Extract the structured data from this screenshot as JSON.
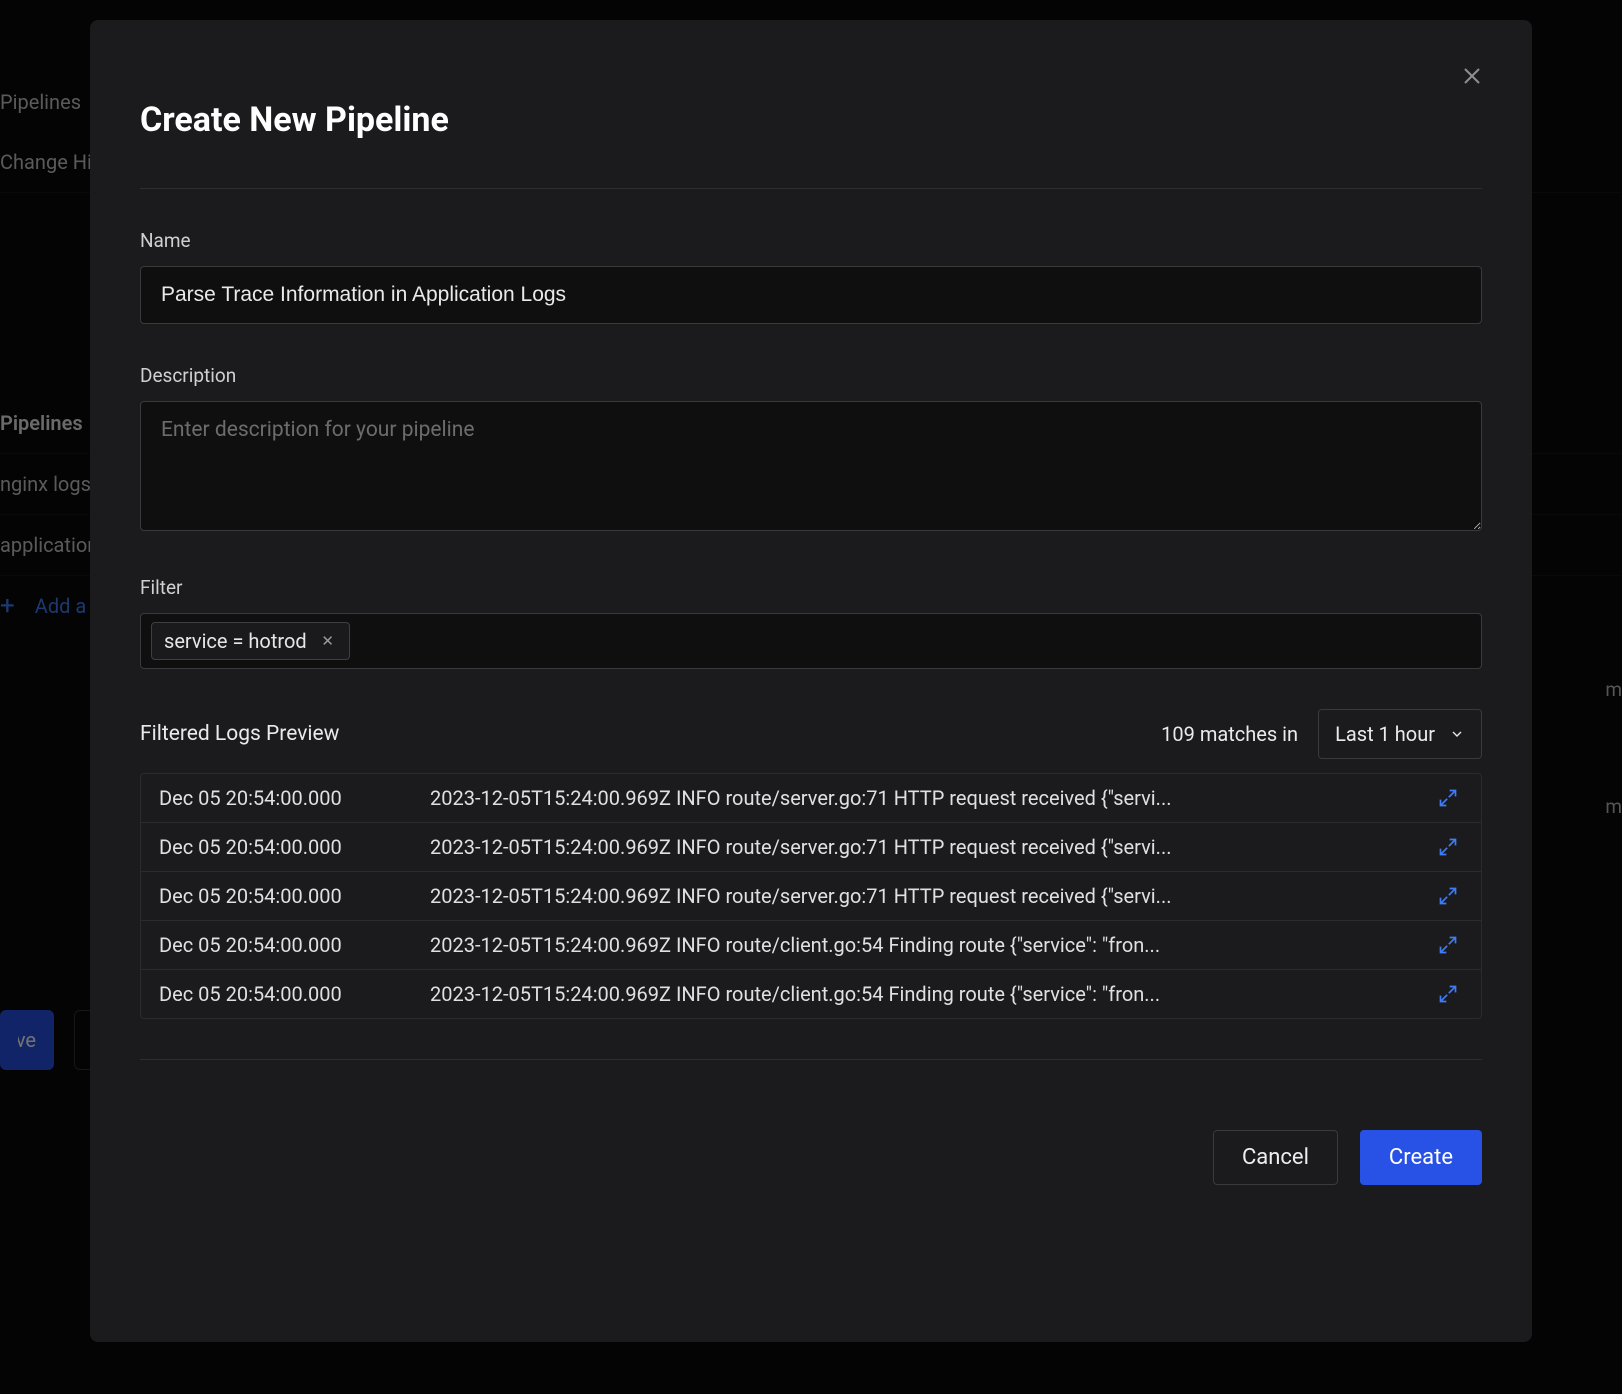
{
  "background": {
    "nav1": "Pipelines",
    "nav2": "Change History",
    "section_title": "Pipelines",
    "row1": "nginx logs",
    "row2": "application",
    "add_label": "Add a New Pipeline",
    "ts_suffix": "m",
    "save_label": "Save"
  },
  "modal": {
    "title": "Create New Pipeline",
    "name_label": "Name",
    "name_value": "Parse Trace Information in Application Logs",
    "description_label": "Description",
    "description_placeholder": "Enter description for your pipeline",
    "description_value": "",
    "filter_label": "Filter",
    "filter_chips": [
      {
        "text": "service = hotrod"
      }
    ],
    "preview_title": "Filtered Logs Preview",
    "match_count": "109",
    "match_suffix": "matches in",
    "range_label": "Last 1 hour",
    "logs": [
      {
        "ts": "Dec 05 20:54:00.000",
        "msg": "2023-12-05T15:24:00.969Z INFO route/server.go:71 HTTP request received {\"servi..."
      },
      {
        "ts": "Dec 05 20:54:00.000",
        "msg": "2023-12-05T15:24:00.969Z INFO route/server.go:71 HTTP request received {\"servi..."
      },
      {
        "ts": "Dec 05 20:54:00.000",
        "msg": "2023-12-05T15:24:00.969Z INFO route/server.go:71 HTTP request received {\"servi..."
      },
      {
        "ts": "Dec 05 20:54:00.000",
        "msg": "2023-12-05T15:24:00.969Z INFO route/client.go:54 Finding route {\"service\": \"fron..."
      },
      {
        "ts": "Dec 05 20:54:00.000",
        "msg": "2023-12-05T15:24:00.969Z INFO route/client.go:54 Finding route {\"service\": \"fron..."
      }
    ],
    "cancel_label": "Cancel",
    "create_label": "Create"
  }
}
